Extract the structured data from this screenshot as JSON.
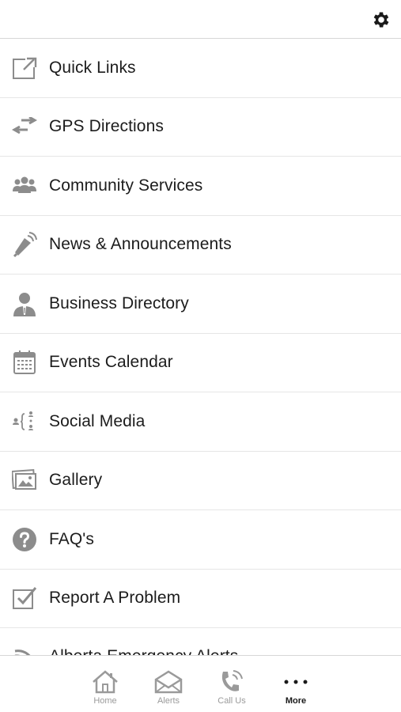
{
  "header": {
    "settings_icon": "gear-icon"
  },
  "menu": {
    "items": [
      {
        "label": "Quick Links",
        "icon": "external-link-icon"
      },
      {
        "label": "GPS Directions",
        "icon": "arrows-exchange-icon"
      },
      {
        "label": "Community Services",
        "icon": "people-group-icon"
      },
      {
        "label": "News & Announcements",
        "icon": "megaphone-icon"
      },
      {
        "label": "Business Directory",
        "icon": "businessman-icon"
      },
      {
        "label": "Events Calendar",
        "icon": "calendar-icon"
      },
      {
        "label": "Social Media",
        "icon": "social-network-icon"
      },
      {
        "label": "Gallery",
        "icon": "photo-gallery-icon"
      },
      {
        "label": "FAQ's",
        "icon": "question-circle-icon"
      },
      {
        "label": "Report A Problem",
        "icon": "checkbox-icon"
      },
      {
        "label": "Alberta Emergency Alerts",
        "icon": "broadcast-icon"
      }
    ]
  },
  "tabbar": {
    "tabs": [
      {
        "label": "Home",
        "icon": "home-icon",
        "active": false
      },
      {
        "label": "Alerts",
        "icon": "envelope-alert-icon",
        "active": false
      },
      {
        "label": "Call Us",
        "icon": "phone-icon",
        "active": false
      },
      {
        "label": "More",
        "icon": "more-dots-icon",
        "active": true
      }
    ]
  },
  "colors": {
    "icon_gray": "#8c8c8c",
    "text": "#1c1c1c",
    "divider": "#e6e6e6",
    "active_tab": "#1a1a1a"
  }
}
